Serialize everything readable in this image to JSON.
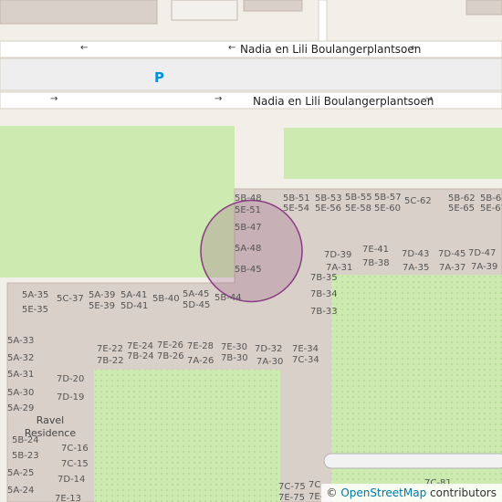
{
  "street": {
    "north_name": "Nadia en Lili Boulangerplantsoen",
    "south_name": "Nadia en Lili Boulangerplantsoen",
    "north_arrow": "←",
    "south_arrow": "→"
  },
  "parking_symbol": "P",
  "place_name": "Ravel Residence",
  "unit_labels": [
    "5B-48",
    "5E-51",
    "5B-47",
    "5A-48",
    "5B-45",
    "5B-44",
    "5B-51",
    "5E-54",
    "5B-53",
    "5E-56",
    "5B-55",
    "5E-58",
    "5B-57",
    "5E-60",
    "5C-62",
    "5B-62",
    "5E-65",
    "5B-64",
    "5E-67",
    "7D-39",
    "7A-31",
    "7E-41",
    "7B-38",
    "7D-43",
    "7A-35",
    "7D-45",
    "7A-37",
    "7D-47",
    "7A-39",
    "7B-35",
    "7B-34",
    "7B-33",
    "5A-35",
    "5E-35",
    "5C-37",
    "5A-39",
    "5E-39",
    "5A-41",
    "5D-41",
    "5B-40",
    "5A-45",
    "5D-45",
    "5A-33",
    "5A-32",
    "5A-31",
    "5A-30",
    "5A-29",
    "7E-22",
    "7B-22",
    "7E-24",
    "7B-24",
    "7E-26",
    "7B-26",
    "7E-28",
    "7A-26",
    "7E-30",
    "7B-30",
    "7D-32",
    "7A-30",
    "7E-34",
    "7C-34",
    "7D-20",
    "7D-19",
    "5B-24",
    "5B-23",
    "5A-25",
    "5A-24",
    "7C-16",
    "7C-15",
    "7D-14",
    "7E-13",
    "7C-75",
    "7E-75",
    "7C-",
    "7E-",
    "7C-81"
  ],
  "attribution": {
    "symbol": "©",
    "link_text": "OpenStreetMap",
    "suffix": "contributors"
  }
}
